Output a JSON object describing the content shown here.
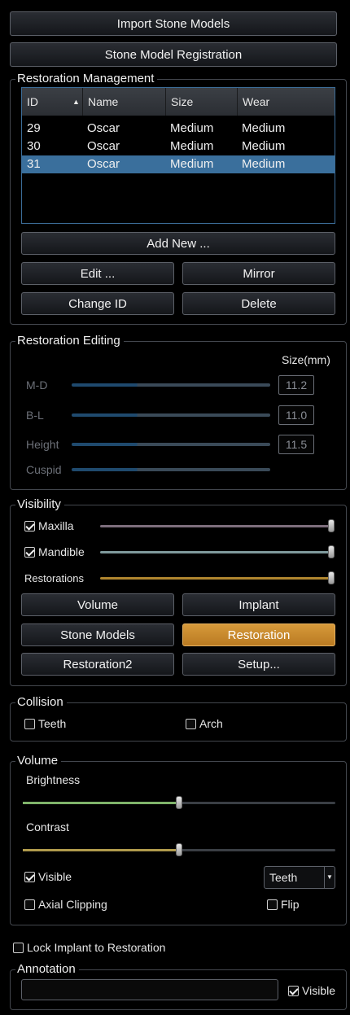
{
  "top": {
    "import_label": "Import Stone Models",
    "registration_label": "Stone Model Registration"
  },
  "restoration_management": {
    "title": "Restoration Management",
    "columns": [
      "ID",
      "Name",
      "Size",
      "Wear"
    ],
    "sort_indicator": "ascending",
    "rows": [
      {
        "id": "29",
        "name": "Oscar",
        "size": "Medium",
        "wear": "Medium"
      },
      {
        "id": "30",
        "name": "Oscar",
        "size": "Medium",
        "wear": "Medium"
      },
      {
        "id": "31",
        "name": "Oscar",
        "size": "Medium",
        "wear": "Medium"
      }
    ],
    "add_new_label": "Add New ...",
    "edit_label": "Edit ...",
    "mirror_label": "Mirror",
    "change_id_label": "Change ID",
    "delete_label": "Delete"
  },
  "restoration_editing": {
    "title": "Restoration Editing",
    "size_header": "Size(mm)",
    "rows": [
      {
        "label": "M-D",
        "value": "11.2"
      },
      {
        "label": "B-L",
        "value": "11.0"
      },
      {
        "label": "Height",
        "value": "11.5"
      },
      {
        "label": "Cuspid",
        "value": ""
      }
    ]
  },
  "visibility": {
    "title": "Visibility",
    "maxilla_label": "Maxilla",
    "maxilla_checked": true,
    "mandible_label": "Mandible",
    "mandible_checked": true,
    "restorations_label": "Restorations",
    "volume_label": "Volume",
    "implant_label": "Implant",
    "stone_models_label": "Stone Models",
    "restoration_label": "Restoration",
    "restoration2_label": "Restoration2",
    "setup_label": "Setup..."
  },
  "collision": {
    "title": "Collision",
    "teeth_label": "Teeth",
    "teeth_checked": false,
    "arch_label": "Arch",
    "arch_checked": false
  },
  "volume": {
    "title": "Volume",
    "brightness_label": "Brightness",
    "brightness_level": 0.5,
    "contrast_label": "Contrast",
    "contrast_level": 0.5,
    "visible_label": "Visible",
    "visible_checked": true,
    "preset_value": "Teeth",
    "axial_clipping_label": "Axial Clipping",
    "axial_clipping_checked": false,
    "flip_label": "Flip",
    "flip_checked": false
  },
  "lock_implant_label": "Lock Implant to Restoration",
  "annotation": {
    "title": "Annotation",
    "text_value": "",
    "visible_label": "Visible",
    "visible_checked": true
  },
  "colors": {
    "accent_active": "#c98b2e",
    "selection": "#3a6f9c",
    "maxilla_track": "#8a7a86",
    "mandible_track": "#7f9a9c",
    "restorations_track": "#b0862f",
    "brightness_fill": "#7fb36a",
    "contrast_fill": "#b09a4c"
  }
}
